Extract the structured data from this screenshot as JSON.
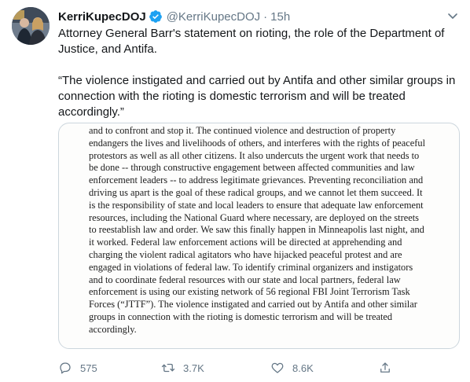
{
  "tweet": {
    "display_name": "KerriKupecDOJ",
    "handle": "@KerriKupecDOJ",
    "separator": "·",
    "time": "15h",
    "text_line1": "Attorney General Barr's statement on rioting, the role of the Department of Justice, and Antifa.",
    "text_line2": "“The violence instigated and carried out by Antifa and other similar groups in connection with the rioting is domestic terrorism and will be treated accordingly.”"
  },
  "document_lines": [
    "and to confront and stop it.  The continued violence and destruction of property",
    "endangers the lives and livelihoods of others, and interferes with the rights of peaceful",
    "protestors as well as all other citizens.  It also undercuts the urgent work that needs to",
    "be done -- through constructive engagement between affected communities and law",
    "enforcement leaders -- to address legitimate grievances.  Preventing reconciliation and",
    "driving us apart is the goal of these radical groups, and we cannot let them succeed.  It",
    "is the responsibility of state and local leaders to ensure that adequate law enforcement",
    "resources, including the National Guard where necessary, are deployed on the streets",
    "to reestablish law and order.  We saw this finally happen in Minneapolis last night, and",
    "it worked.  Federal law enforcement actions will be directed at apprehending and",
    "charging the violent radical agitators who have hijacked peaceful protest and are",
    "engaged in violations of federal law.  To identify criminal organizers and instigators",
    "and to coordinate federal resources with our state and local partners, federal law",
    "enforcement is using our existing network of 56 regional FBI Joint Terrorism Task",
    "Forces (“JTTF”).  The violence instigated and carried out by Antifa and other similar",
    "groups in connection with the rioting is domestic terrorism and will be treated",
    "accordingly."
  ],
  "actions": {
    "reply_count": "575",
    "retweet_count": "3.7K",
    "like_count": "8.6K",
    "reply_icon": "reply-icon",
    "retweet_icon": "retweet-icon",
    "like_icon": "like-icon",
    "share_icon": "share-icon"
  },
  "colors": {
    "verified": "#1da1f2",
    "secondary_text": "#657786",
    "border": "#ccd6dd"
  }
}
